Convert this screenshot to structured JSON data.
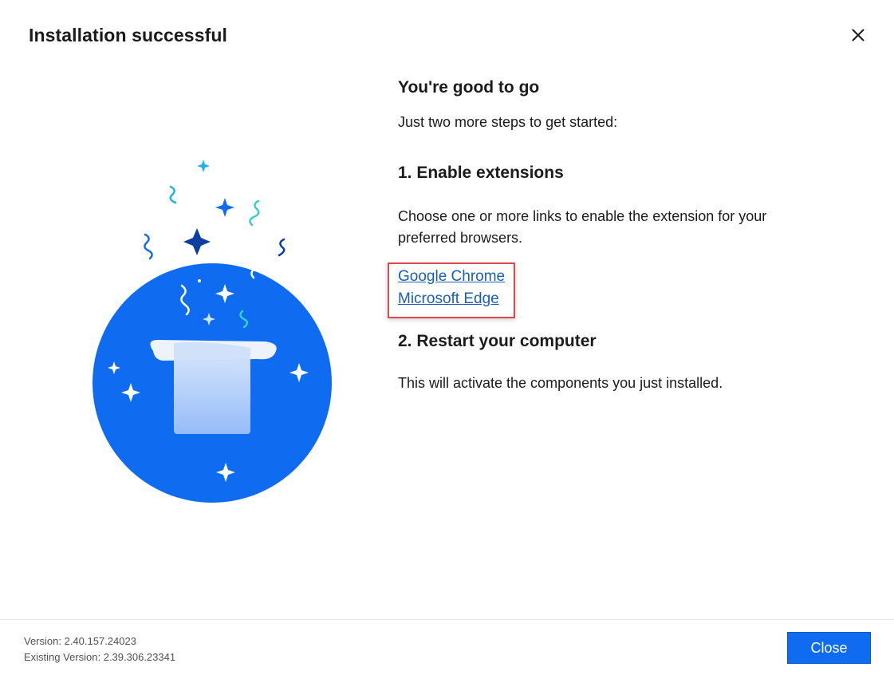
{
  "dialog": {
    "title": "Installation successful"
  },
  "content": {
    "heading": "You're good to go",
    "subtitle": "Just two more steps to get started:",
    "step1": {
      "heading": "1. Enable extensions",
      "description": "Choose one or more links to enable the extension for your preferred browsers.",
      "links": [
        {
          "label": "Google Chrome"
        },
        {
          "label": "Microsoft Edge"
        }
      ]
    },
    "step2": {
      "heading": "2. Restart your computer",
      "description": "This will activate the components you just installed."
    }
  },
  "footer": {
    "version": "Version: 2.40.157.24023",
    "existing_version": "Existing Version: 2.39.306.23341",
    "close_label": "Close"
  },
  "colors": {
    "accent": "#0f6cf0",
    "link": "#1a5fb4",
    "highlight_border": "#e0474c",
    "illustration_circle": "#0f6cf0"
  },
  "icons": {
    "close": "close-icon",
    "illustration": "magic-hat-illustration"
  }
}
